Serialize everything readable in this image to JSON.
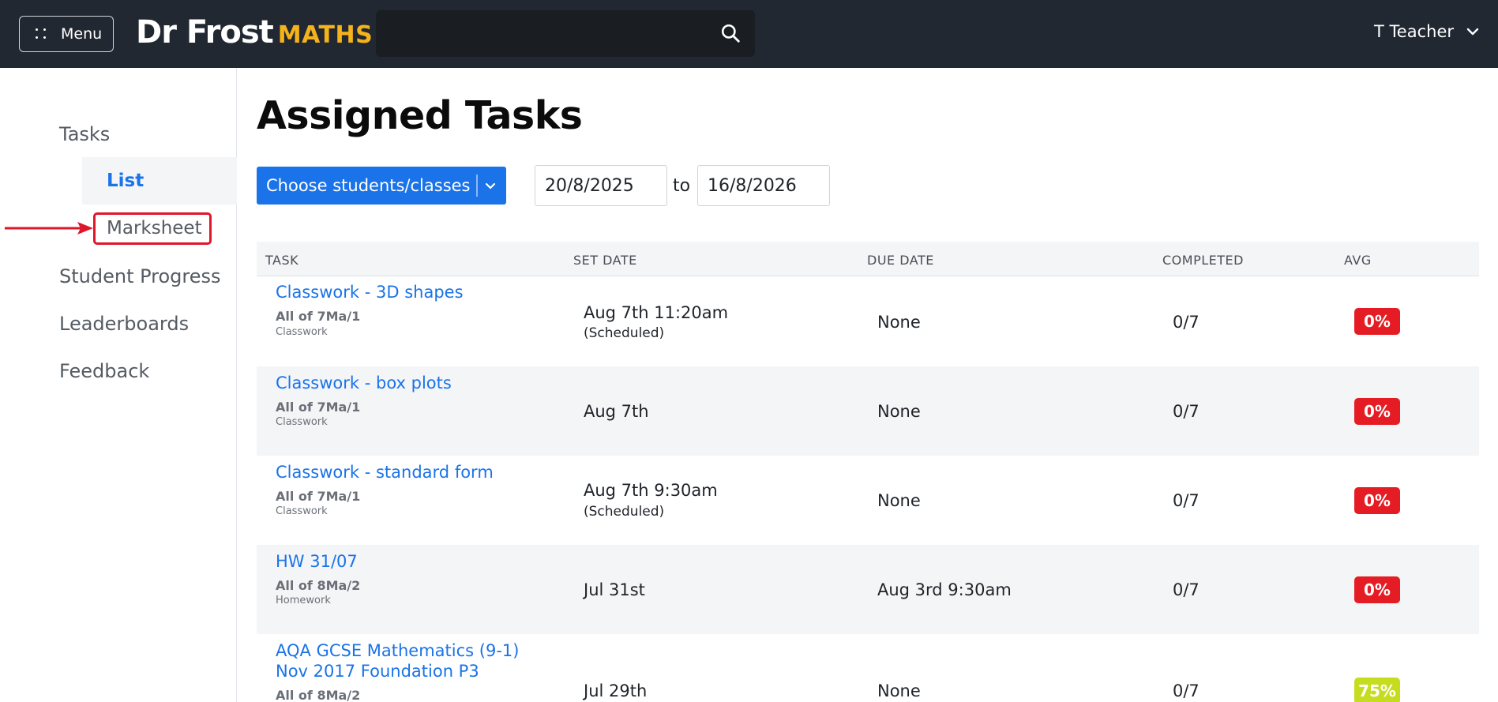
{
  "header": {
    "menu_label": "Menu",
    "logo_part1": "Dr Frost",
    "logo_part2": "MATHS",
    "search_value": "",
    "user_name": "T Teacher"
  },
  "sidebar": {
    "items": [
      {
        "label": "Tasks"
      },
      {
        "label": "List"
      },
      {
        "label": "Marksheet"
      },
      {
        "label": "Student Progress"
      },
      {
        "label": "Leaderboards"
      },
      {
        "label": "Feedback"
      }
    ]
  },
  "main": {
    "title": "Assigned Tasks",
    "choose_label": "Choose students/classes",
    "date_from": "20/8/2025",
    "to_label": "to",
    "date_to": "16/8/2026"
  },
  "table": {
    "headers": [
      "TASK",
      "SET DATE",
      "DUE DATE",
      "COMPLETED",
      "AVG"
    ],
    "rows": [
      {
        "task_line1": "Classwork - 3D shapes",
        "task_line2": "",
        "class": "All of 7Ma/1",
        "type": "Classwork",
        "set_date": "Aug 7th 11:20am",
        "scheduled": "(Scheduled)",
        "due_date": "None",
        "completed": "0/7",
        "avg": "0%",
        "avg_color": "#e51c23"
      },
      {
        "task_line1": "Classwork - box plots",
        "task_line2": "",
        "class": "All of 7Ma/1",
        "type": "Classwork",
        "set_date": "Aug 7th",
        "scheduled": "",
        "due_date": "None",
        "completed": "0/7",
        "avg": "0%",
        "avg_color": "#e51c23"
      },
      {
        "task_line1": "Classwork - standard form",
        "task_line2": "",
        "class": "All of 7Ma/1",
        "type": "Classwork",
        "set_date": "Aug 7th 9:30am",
        "scheduled": "(Scheduled)",
        "due_date": "None",
        "completed": "0/7",
        "avg": "0%",
        "avg_color": "#e51c23"
      },
      {
        "task_line1": "HW 31/07",
        "task_line2": "",
        "class": "All of 8Ma/2",
        "type": "Homework",
        "set_date": "Jul 31st",
        "scheduled": "",
        "due_date": "Aug 3rd 9:30am",
        "completed": "0/7",
        "avg": "0%",
        "avg_color": "#e51c23"
      },
      {
        "task_line1": "AQA GCSE Mathematics (9-1)",
        "task_line2": "Nov 2017 Foundation P3",
        "class": "All of 8Ma/2",
        "type": "",
        "set_date": "Jul 29th",
        "scheduled": "",
        "due_date": "None",
        "completed": "0/7",
        "avg": "75%",
        "avg_color": "#c6dc1e"
      }
    ]
  },
  "colors": {
    "header_bg": "#222831",
    "accent": "#1a73e8",
    "logo_accent": "#f4b21b",
    "highlight": "#e0162b"
  }
}
